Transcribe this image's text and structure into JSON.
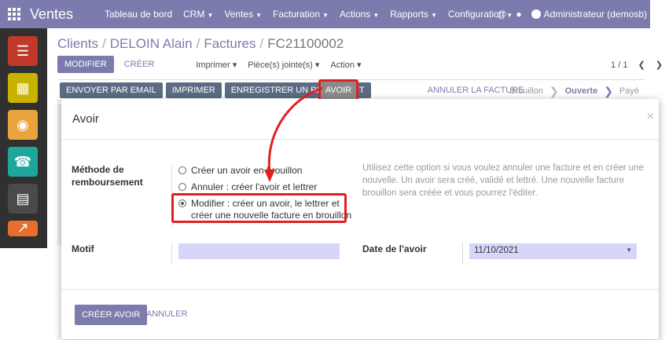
{
  "app": {
    "name": "Ventes"
  },
  "navbar": {
    "menu": [
      "Tableau de bord",
      "CRM",
      "Ventes",
      "Facturation",
      "Actions",
      "Rapports",
      "Configuration"
    ],
    "menu_has_caret": [
      false,
      true,
      true,
      true,
      true,
      true,
      true
    ],
    "user": "Administrateur (demosb)"
  },
  "dock": {
    "apps": [
      "discuss-icon",
      "calendar-icon",
      "location-icon",
      "contacts-icon",
      "inventory-icon",
      "sales-icon"
    ],
    "colors": [
      "#c0392b",
      "#c8b400",
      "#e8a33d",
      "#1fa69a",
      "#4a4a4a",
      "#e86f2a"
    ]
  },
  "breadcrumb": {
    "items": [
      "Clients",
      "DELOIN Alain",
      "Factures"
    ],
    "current": "FC21100002"
  },
  "toolbar": {
    "edit": "MODIFIER",
    "create": "CRÉER",
    "print": "Imprimer",
    "attachments": "Pièce(s) jointe(s)",
    "action": "Action"
  },
  "pager": {
    "value": "1 / 1"
  },
  "status_buttons": {
    "send": "ENVOYER PAR EMAIL",
    "print": "IMPRIMER",
    "payment": "ENREGISTRER UN RÈGLEMENT",
    "credit": "AVOIR",
    "cancel": "ANNULER LA FACTURE"
  },
  "stages": {
    "draft": "Brouillon",
    "open": "Ouverte",
    "paid": "Payé"
  },
  "modal": {
    "title": "Avoir",
    "method_label": "Méthode de remboursement",
    "options": [
      {
        "text": "Créer un avoir en brouillon",
        "checked": false
      },
      {
        "text": "Annuler : créer l'avoir et lettrer",
        "checked": false
      },
      {
        "text": "Modifier : créer un avoir, le lettrer et créer une nouvelle facture en brouillon",
        "checked": true
      }
    ],
    "help": "Utilisez cette option si vous voulez annuler une facture et en créer une nouvelle. Un avoir sera créé, validé et lettré. Une nouvelle facture brouillon sera créée et vous pourrez l'éditer.",
    "motif_label": "Motif",
    "motif_value": "",
    "date_label": "Date de l'avoir",
    "date_value": "11/10/2021",
    "create_button": "CRÉER AVOIR",
    "cancel_button": "ANNULER"
  },
  "colors": {
    "brand": "#7c7bad",
    "highlight": "#e02020",
    "input_bg": "#d6d6fb"
  }
}
